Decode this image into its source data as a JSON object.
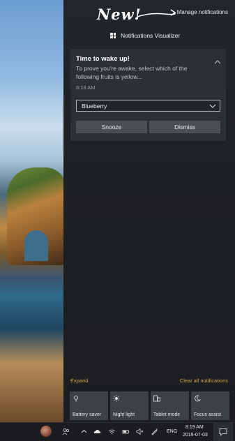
{
  "annotation": {
    "new_text": "New!"
  },
  "action_center": {
    "manage_label": "Manage notifications",
    "app_name": "Notifications Visualizer",
    "toast": {
      "title": "Time to wake up!",
      "body": "To prove you're awake, select which of the following fruits is yellow...",
      "time": "8:18 AM",
      "select_value": "Blueberry",
      "buttons": {
        "snooze": "Snooze",
        "dismiss": "Dismiss"
      }
    },
    "expand_label": "Expand",
    "clear_all_label": "Clear all notifications",
    "quick_actions": [
      {
        "label": "Battery saver",
        "icon": "battery-saver-icon"
      },
      {
        "label": "Night light",
        "icon": "night-light-icon"
      },
      {
        "label": "Tablet mode",
        "icon": "tablet-mode-icon"
      },
      {
        "label": "Focus assist",
        "icon": "focus-assist-icon"
      }
    ]
  },
  "taskbar": {
    "language": "ENG",
    "time": "8:19 AM",
    "date": "2019-07-03"
  }
}
